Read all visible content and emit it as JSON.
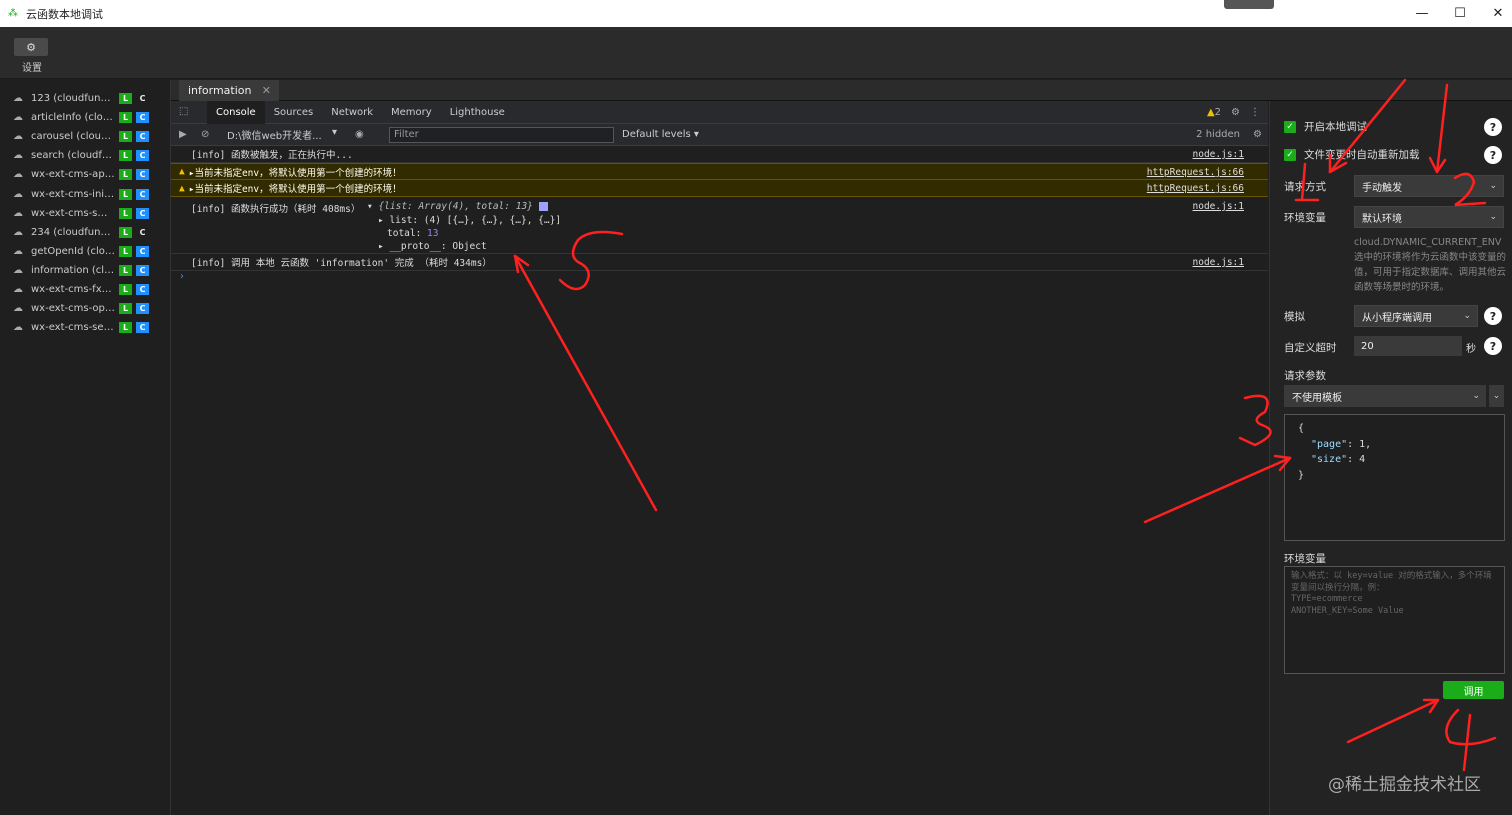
{
  "window": {
    "title": "云函数本地调试"
  },
  "toolbar": {
    "settings_label": "设置"
  },
  "sidebar": {
    "functions": [
      {
        "name": "123 (cloudfuncti...",
        "badge_l": "L",
        "badge_c": "C",
        "c_plain": true
      },
      {
        "name": "articleInfo (cloud...",
        "badge_l": "L",
        "badge_c": "C",
        "c_plain": false
      },
      {
        "name": "carousel (cloudf...",
        "badge_l": "L",
        "badge_c": "C",
        "c_plain": false
      },
      {
        "name": "search (cloudfun...",
        "badge_l": "L",
        "badge_c": "C",
        "c_plain": false
      },
      {
        "name": "wx-ext-cms-api (...",
        "badge_l": "L",
        "badge_c": "C",
        "c_plain": false
      },
      {
        "name": "wx-ext-cms-init (...",
        "badge_l": "L",
        "badge_c": "C",
        "c_plain": false
      },
      {
        "name": "wx-ext-cms-sms ...",
        "badge_l": "L",
        "badge_c": "C",
        "c_plain": false
      },
      {
        "name": "234 (cloudfuncti...",
        "badge_l": "L",
        "badge_c": "C",
        "c_plain": true
      },
      {
        "name": "getOpenId (clou...",
        "badge_l": "L",
        "badge_c": "C",
        "c_plain": false
      },
      {
        "name": "information (clou...",
        "badge_l": "L",
        "badge_c": "C",
        "c_plain": false
      },
      {
        "name": "wx-ext-cms-fx-o...",
        "badge_l": "L",
        "badge_c": "C",
        "c_plain": false
      },
      {
        "name": "wx-ext-cms-ope...",
        "badge_l": "L",
        "badge_c": "C",
        "c_plain": false
      },
      {
        "name": "wx-ext-cms-servi...",
        "badge_l": "L",
        "badge_c": "C",
        "c_plain": false
      }
    ]
  },
  "editor_tab": {
    "label": "information"
  },
  "devtools": {
    "tabs": [
      "Console",
      "Sources",
      "Network",
      "Memory",
      "Lighthouse"
    ],
    "warn_count": "2",
    "context": "D:\\微信web开发者...",
    "filter_placeholder": "Filter",
    "levels": "Default levels ▾",
    "hidden": "2 hidden"
  },
  "console": {
    "l1": {
      "text": "[info] 函数被触发，正在执行中...",
      "src": "node.js:1"
    },
    "w1": {
      "text": "▸当前未指定env，将默认使用第一个创建的环境！",
      "src": "httpRequest.js:66"
    },
    "w2": {
      "text": "▸当前未指定env，将默认使用第一个创建的环境！",
      "src": "httpRequest.js:66"
    },
    "l2": {
      "text": "[info] 函数执行成功（耗时 408ms）",
      "obj": "{list: Array(4), total: 13}",
      "src": "node.js:1"
    },
    "tree1": "list: (4) [{…}, {…}, {…}, {…}]",
    "tree2_key": "total: ",
    "tree2_val": "13",
    "tree3": "__proto__: Object",
    "l3": {
      "text": "[info] 调用 本地 云函数 'information' 完成 （耗时 434ms）",
      "src": "node.js:1"
    },
    "prompt": "›"
  },
  "panel": {
    "chk1": "开启本地调试",
    "chk2": "文件变更时自动重新加载",
    "request_mode_label": "请求方式",
    "request_mode_value": "手动触发",
    "env_label": "环境变量",
    "env_value": "默认环境",
    "env_hint": "cloud.DYNAMIC_CURRENT_ENV 选中的环境将作为云函数中该变量的值，可用于指定数据库、调用其他云函数等场景时的环境。",
    "simulate_label": "模拟",
    "simulate_value": "从小程序端调用",
    "timeout_label": "自定义超时",
    "timeout_value": "20",
    "timeout_unit": "秒",
    "params_label": "请求参数",
    "template_value": "不使用模板",
    "json_open": "{",
    "json_k1": "\"page\"",
    "json_v1": ": 1,",
    "json_k2": "\"size\"",
    "json_v2": ": 4",
    "json_close": "}",
    "envvars_label": "环境变量",
    "envvars_placeholder": "输入格式：以 key=value 对的格式输入，多个环境变量间以换行分隔，例：\nTYPE=ecommerce\nANOTHER_KEY=Some Value",
    "call_button": "调用",
    "help": "?"
  },
  "watermark": "@稀土掘金技术社区",
  "annotations": {
    "color": "#ff2020",
    "marks": [
      "1",
      "2",
      "3",
      "4",
      "5"
    ]
  }
}
